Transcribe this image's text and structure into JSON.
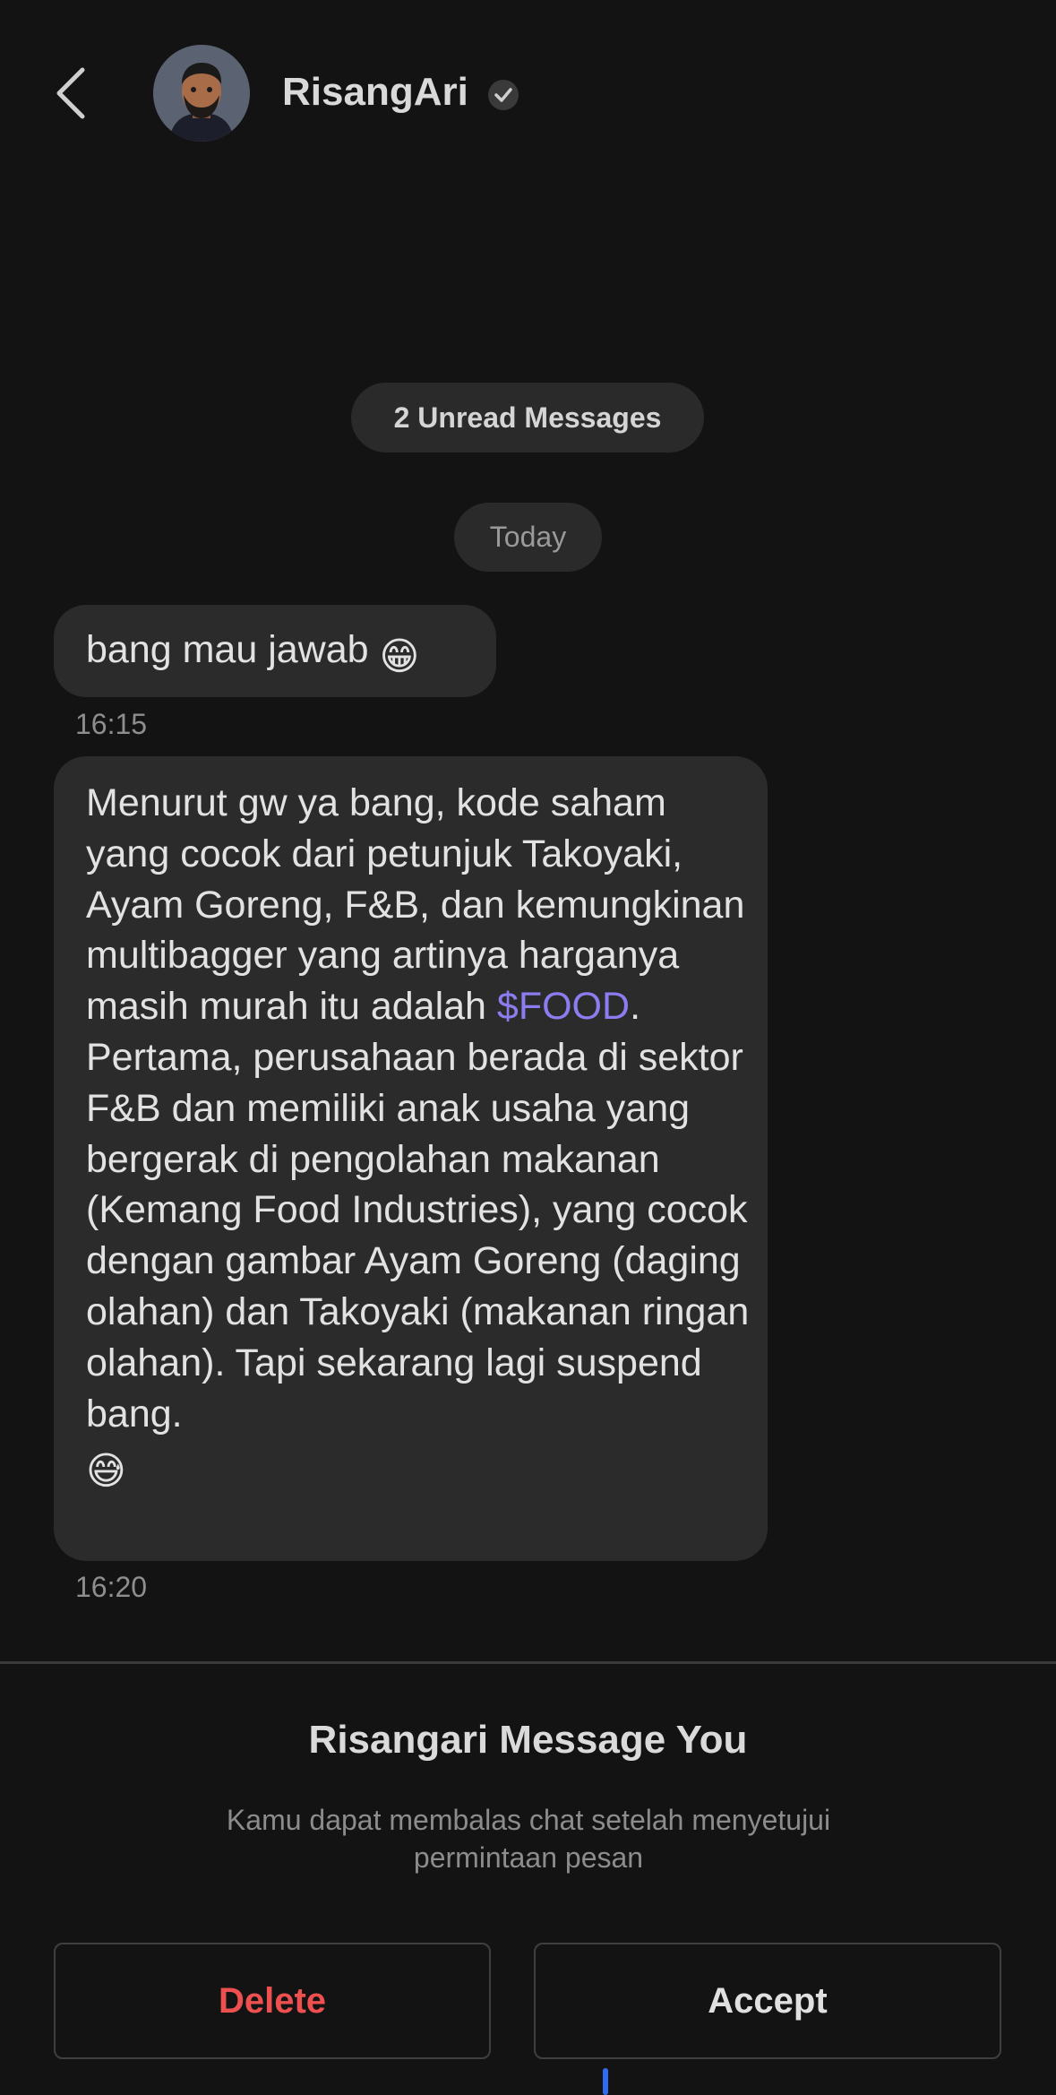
{
  "header": {
    "contact_name": "RisangAri"
  },
  "chat": {
    "unread_label": "2 Unread Messages",
    "date_label": "Today",
    "messages": [
      {
        "text": "bang mau jawab",
        "emoji": "😁",
        "time": "16:15"
      },
      {
        "text_before": "Menurut gw ya bang, kode saham yang cocok dari petunjuk Takoyaki, Ayam Goreng, F&B, dan kemungkinan multibagger yang artinya harganya masih murah itu adalah ",
        "ticker": "$FOOD",
        "text_after": ". Pertama, perusahaan berada di sektor F&B dan memiliki anak usaha yang bergerak di pengolahan makanan (Kemang Food Industries), yang cocok dengan gambar Ayam Goreng (daging olahan) dan Takoyaki (makanan ringan olahan). Tapi sekarang lagi suspend bang.",
        "emoji": "😅",
        "time": "16:20"
      }
    ]
  },
  "request": {
    "title": "Risangari Message You",
    "subtitle": "Kamu dapat membalas chat setelah menyetujui permintaan pesan",
    "delete_label": "Delete",
    "accept_label": "Accept"
  },
  "colors": {
    "background": "#131313",
    "bubble": "#2b2b2b",
    "ticker": "#8b7df0",
    "delete": "#ee4f4f",
    "accent_indicator": "#2f6cf0"
  },
  "icons": [
    "chevron-left-icon",
    "verified-check-icon",
    "avatar"
  ]
}
